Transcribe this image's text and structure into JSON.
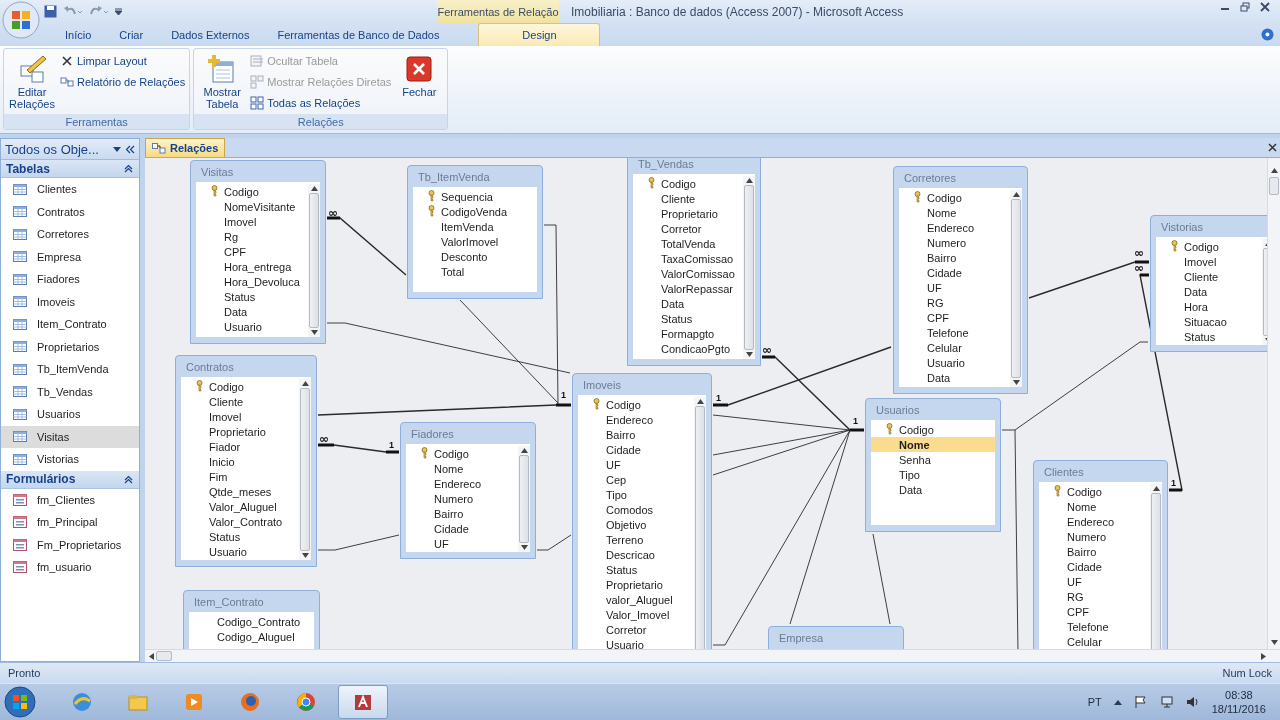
{
  "window": {
    "title": "Imobiliaria : Banco de dados (Access 2007) - Microsoft Access",
    "context_tab_group": "Ferramentas de Relação"
  },
  "ribbon_tabs": [
    {
      "label": "Início",
      "selected": false
    },
    {
      "label": "Criar",
      "selected": false
    },
    {
      "label": "Dados Externos",
      "selected": false
    },
    {
      "label": "Ferramentas de Banco de Dados",
      "selected": false
    },
    {
      "label": "Design",
      "selected": true
    }
  ],
  "ribbon_groups": [
    {
      "label": "Ferramentas",
      "commands": [
        {
          "label": "Editar Relações",
          "kind": "large",
          "disabled": false
        },
        {
          "label": "Limpar Layout",
          "kind": "small",
          "disabled": false
        },
        {
          "label": "Relatório de Relações",
          "kind": "small",
          "disabled": false
        }
      ]
    },
    {
      "label": "Relações",
      "commands": [
        {
          "label": "Mostrar Tabela",
          "kind": "large",
          "disabled": false
        },
        {
          "label": "Ocultar Tabela",
          "kind": "small",
          "disabled": true
        },
        {
          "label": "Mostrar Relações Diretas",
          "kind": "small",
          "disabled": true
        },
        {
          "label": "Todas as Relações",
          "kind": "small",
          "disabled": false
        },
        {
          "label": "Fechar",
          "kind": "large",
          "disabled": false
        }
      ]
    }
  ],
  "navigation": {
    "title": "Todos os Obje...",
    "groups": [
      {
        "label": "Tabelas",
        "kind": "tables",
        "expanded": true,
        "items": [
          {
            "label": "Clientes",
            "selected": false
          },
          {
            "label": "Contratos",
            "selected": false
          },
          {
            "label": "Corretores",
            "selected": false
          },
          {
            "label": "Empresa",
            "selected": false
          },
          {
            "label": "Fiadores",
            "selected": false
          },
          {
            "label": "Imoveis",
            "selected": false
          },
          {
            "label": "Item_Contrato",
            "selected": false
          },
          {
            "label": "Proprietarios",
            "selected": false
          },
          {
            "label": "Tb_ItemVenda",
            "selected": false
          },
          {
            "label": "Tb_Vendas",
            "selected": false
          },
          {
            "label": "Usuarios",
            "selected": false
          },
          {
            "label": "Visitas",
            "selected": true
          },
          {
            "label": "Vistorias",
            "selected": false
          }
        ]
      },
      {
        "label": "Formulários",
        "kind": "forms",
        "expanded": true,
        "items": [
          {
            "label": "fm_Clientes",
            "selected": false
          },
          {
            "label": "fm_Principal",
            "selected": false
          },
          {
            "label": "Fm_Proprietarios",
            "selected": false
          },
          {
            "label": "fm_usuario",
            "selected": false
          }
        ]
      }
    ]
  },
  "document_tab": {
    "label": "Relações"
  },
  "tables": [
    {
      "title": "Visitas",
      "fields": [
        {
          "name": "Codigo",
          "key": true,
          "selected": false
        },
        {
          "name": "NomeVisitante",
          "key": false,
          "selected": false
        },
        {
          "name": "Imovel",
          "key": false,
          "selected": false
        },
        {
          "name": "Rg",
          "key": false,
          "selected": false
        },
        {
          "name": "CPF",
          "key": false,
          "selected": false
        },
        {
          "name": "Hora_entrega",
          "key": false,
          "selected": false
        },
        {
          "name": "Hora_Devoluca",
          "key": false,
          "selected": false
        },
        {
          "name": "Status",
          "key": false,
          "selected": false
        },
        {
          "name": "Data",
          "key": false,
          "selected": false
        },
        {
          "name": "Usuario",
          "key": false,
          "selected": false
        }
      ]
    },
    {
      "title": "Tb_ItemVenda",
      "fields": [
        {
          "name": "Sequencia",
          "key": true,
          "selected": false
        },
        {
          "name": "CodigoVenda",
          "key": true,
          "selected": false
        },
        {
          "name": "ItemVenda",
          "key": false,
          "selected": false
        },
        {
          "name": "ValorImovel",
          "key": false,
          "selected": false
        },
        {
          "name": "Desconto",
          "key": false,
          "selected": false
        },
        {
          "name": "Total",
          "key": false,
          "selected": false
        }
      ]
    },
    {
      "title": "Tb_Vendas",
      "fields": [
        {
          "name": "Codigo",
          "key": true,
          "selected": false
        },
        {
          "name": "Cliente",
          "key": false,
          "selected": false
        },
        {
          "name": "Proprietario",
          "key": false,
          "selected": false
        },
        {
          "name": "Corretor",
          "key": false,
          "selected": false
        },
        {
          "name": "TotalVenda",
          "key": false,
          "selected": false
        },
        {
          "name": "TaxaComissao",
          "key": false,
          "selected": false
        },
        {
          "name": "ValorComissao",
          "key": false,
          "selected": false
        },
        {
          "name": "ValorRepassar",
          "key": false,
          "selected": false
        },
        {
          "name": "Data",
          "key": false,
          "selected": false
        },
        {
          "name": "Status",
          "key": false,
          "selected": false
        },
        {
          "name": "Formapgto",
          "key": false,
          "selected": false
        },
        {
          "name": "CondicaoPgto",
          "key": false,
          "selected": false
        }
      ]
    },
    {
      "title": "Corretores",
      "fields": [
        {
          "name": "Codigo",
          "key": true,
          "selected": false
        },
        {
          "name": "Nome",
          "key": false,
          "selected": false
        },
        {
          "name": "Endereco",
          "key": false,
          "selected": false
        },
        {
          "name": "Numero",
          "key": false,
          "selected": false
        },
        {
          "name": "Bairro",
          "key": false,
          "selected": false
        },
        {
          "name": "Cidade",
          "key": false,
          "selected": false
        },
        {
          "name": "UF",
          "key": false,
          "selected": false
        },
        {
          "name": "RG",
          "key": false,
          "selected": false
        },
        {
          "name": "CPF",
          "key": false,
          "selected": false
        },
        {
          "name": "Telefone",
          "key": false,
          "selected": false
        },
        {
          "name": "Celular",
          "key": false,
          "selected": false
        },
        {
          "name": "Usuario",
          "key": false,
          "selected": false
        },
        {
          "name": "Data",
          "key": false,
          "selected": false
        }
      ]
    },
    {
      "title": "Vistorias",
      "fields": [
        {
          "name": "Codigo",
          "key": true,
          "selected": false
        },
        {
          "name": "Imovel",
          "key": false,
          "selected": false
        },
        {
          "name": "Cliente",
          "key": false,
          "selected": false
        },
        {
          "name": "Data",
          "key": false,
          "selected": false
        },
        {
          "name": "Hora",
          "key": false,
          "selected": false
        },
        {
          "name": "Situacao",
          "key": false,
          "selected": false
        },
        {
          "name": "Status",
          "key": false,
          "selected": false
        }
      ]
    },
    {
      "title": "Contratos",
      "fields": [
        {
          "name": "Codigo",
          "key": true,
          "selected": false
        },
        {
          "name": "Cliente",
          "key": false,
          "selected": false
        },
        {
          "name": "Imovel",
          "key": false,
          "selected": false
        },
        {
          "name": "Proprietario",
          "key": false,
          "selected": false
        },
        {
          "name": "Fiador",
          "key": false,
          "selected": false
        },
        {
          "name": "Inicio",
          "key": false,
          "selected": false
        },
        {
          "name": "Fim",
          "key": false,
          "selected": false
        },
        {
          "name": "Qtde_meses",
          "key": false,
          "selected": false
        },
        {
          "name": "Valor_Aluguel",
          "key": false,
          "selected": false
        },
        {
          "name": "Valor_Contrato",
          "key": false,
          "selected": false
        },
        {
          "name": "Status",
          "key": false,
          "selected": false
        },
        {
          "name": "Usuario",
          "key": false,
          "selected": false
        }
      ]
    },
    {
      "title": "Fiadores",
      "fields": [
        {
          "name": "Codigo",
          "key": true,
          "selected": false
        },
        {
          "name": "Nome",
          "key": false,
          "selected": false
        },
        {
          "name": "Endereco",
          "key": false,
          "selected": false
        },
        {
          "name": "Numero",
          "key": false,
          "selected": false
        },
        {
          "name": "Bairro",
          "key": false,
          "selected": false
        },
        {
          "name": "Cidade",
          "key": false,
          "selected": false
        },
        {
          "name": "UF",
          "key": false,
          "selected": false
        }
      ]
    },
    {
      "title": "Imoveis",
      "fields": [
        {
          "name": "Codigo",
          "key": true,
          "selected": false
        },
        {
          "name": "Endereco",
          "key": false,
          "selected": false
        },
        {
          "name": "Bairro",
          "key": false,
          "selected": false
        },
        {
          "name": "Cidade",
          "key": false,
          "selected": false
        },
        {
          "name": "UF",
          "key": false,
          "selected": false
        },
        {
          "name": "Cep",
          "key": false,
          "selected": false
        },
        {
          "name": "Tipo",
          "key": false,
          "selected": false
        },
        {
          "name": "Comodos",
          "key": false,
          "selected": false
        },
        {
          "name": "Objetivo",
          "key": false,
          "selected": false
        },
        {
          "name": "Terreno",
          "key": false,
          "selected": false
        },
        {
          "name": "Descricao",
          "key": false,
          "selected": false
        },
        {
          "name": "Status",
          "key": false,
          "selected": false
        },
        {
          "name": "Proprietario",
          "key": false,
          "selected": false
        },
        {
          "name": "valor_Aluguel",
          "key": false,
          "selected": false
        },
        {
          "name": "Valor_Imovel",
          "key": false,
          "selected": false
        },
        {
          "name": "Corretor",
          "key": false,
          "selected": false
        },
        {
          "name": "Usuario",
          "key": false,
          "selected": false
        }
      ]
    },
    {
      "title": "Usuarios",
      "fields": [
        {
          "name": "Codigo",
          "key": true,
          "selected": false
        },
        {
          "name": "Nome",
          "key": false,
          "selected": true
        },
        {
          "name": "Senha",
          "key": false,
          "selected": false
        },
        {
          "name": "Tipo",
          "key": false,
          "selected": false
        },
        {
          "name": "Data",
          "key": false,
          "selected": false
        }
      ]
    },
    {
      "title": "Item_Contrato",
      "fields": [
        {
          "name": "Codigo_Contrato",
          "key": false,
          "selected": false
        },
        {
          "name": "Codigo_Aluguel",
          "key": false,
          "selected": false
        }
      ]
    },
    {
      "title": "Empresa"
    },
    {
      "title": "Clientes",
      "fields": [
        {
          "name": "Codigo",
          "key": true,
          "selected": false
        },
        {
          "name": "Nome",
          "key": false,
          "selected": false
        },
        {
          "name": "Endereco",
          "key": false,
          "selected": false
        },
        {
          "name": "Numero",
          "key": false,
          "selected": false
        },
        {
          "name": "Bairro",
          "key": false,
          "selected": false
        },
        {
          "name": "Cidade",
          "key": false,
          "selected": false
        },
        {
          "name": "UF",
          "key": false,
          "selected": false
        },
        {
          "name": "RG",
          "key": false,
          "selected": false
        },
        {
          "name": "CPF",
          "key": false,
          "selected": false
        },
        {
          "name": "Telefone",
          "key": false,
          "selected": false
        },
        {
          "name": "Celular",
          "key": false,
          "selected": false
        }
      ]
    }
  ],
  "relationships": [
    {
      "enforced": true,
      "many_label": "∞"
    },
    {
      "enforced": true,
      "one_label": "1",
      "many_label": "∞"
    },
    {
      "enforced": true,
      "one_label": "1"
    },
    {
      "enforced": true,
      "many_label": "∞"
    },
    {
      "enforced": true,
      "one_label": "1",
      "many_label": "∞"
    },
    {
      "enforced": true,
      "one_label": "1",
      "many_label": "∞"
    },
    {
      "enforced": false
    },
    {
      "enforced": false
    },
    {
      "enforced": false
    },
    {
      "enforced": false
    },
    {
      "enforced": false
    },
    {
      "enforced": false
    },
    {
      "enforced": false
    },
    {
      "enforced": false
    },
    {
      "enforced": false
    },
    {
      "enforced": false
    },
    {
      "enforced": false
    },
    {
      "enforced": true,
      "one_label": "1"
    },
    {
      "enforced": false
    },
    {
      "enforced": false
    }
  ],
  "status_bar": {
    "left": "Pronto",
    "right": "Num Lock"
  },
  "taskbar": {
    "apps": [
      {
        "active": false
      },
      {
        "active": false
      },
      {
        "active": false
      },
      {
        "active": false
      },
      {
        "active": false
      },
      {
        "active": true
      }
    ],
    "language": "PT",
    "time": "08:38",
    "date": "18/11/2016"
  }
}
